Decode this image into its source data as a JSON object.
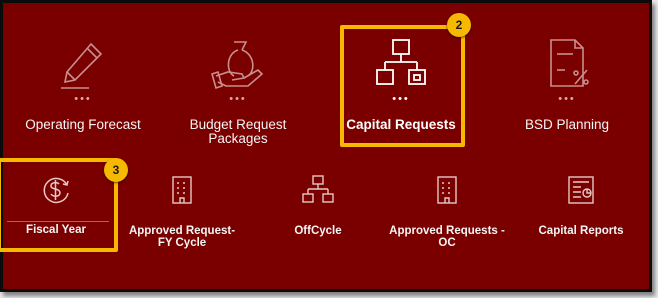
{
  "tiles_top": [
    {
      "label": "Operating Forecast",
      "icon": "pencil-icon"
    },
    {
      "label": "Budget Request Packages",
      "icon": "budget-hand-icon"
    },
    {
      "label": "Capital Requests",
      "icon": "hierarchy-icon"
    },
    {
      "label": "BSD Planning",
      "icon": "document-percent-icon"
    }
  ],
  "tiles_bottom": [
    {
      "label": "Fiscal Year",
      "icon": "dollar-cycle-icon"
    },
    {
      "label": "Approved Request- FY Cycle",
      "icon": "building-icon"
    },
    {
      "label": "OffCycle",
      "icon": "hierarchy-icon"
    },
    {
      "label": "Approved Requests - OC",
      "icon": "building-icon"
    },
    {
      "label": "Capital Reports",
      "icon": "report-icon"
    }
  ],
  "callouts": {
    "capital_requests": "2",
    "fiscal_year": "3"
  },
  "dots": "•••",
  "colors": {
    "background": "#7a0000",
    "highlight": "#f6b800",
    "icon_dim": "#c98e8e",
    "icon_active": "#ffffff"
  }
}
